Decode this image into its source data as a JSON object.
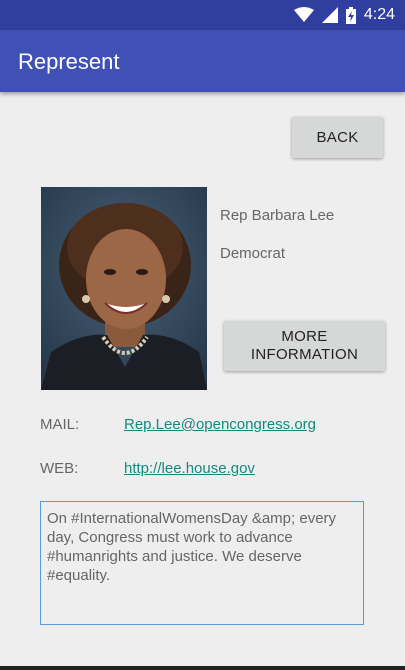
{
  "status_bar": {
    "time": "4:24",
    "icons": [
      "wifi-icon",
      "signal-icon",
      "battery-charging-icon"
    ]
  },
  "app_bar": {
    "title": "Represent"
  },
  "back_button": {
    "label": "BACK"
  },
  "representative": {
    "name": "Rep Barbara Lee",
    "party": "Democrat",
    "photo_alt": "Portrait photo"
  },
  "more_info_button": {
    "label": "MORE INFORMATION"
  },
  "contact": {
    "mail_label": "MAIL:",
    "mail_value": "Rep.Lee@opencongress.org",
    "web_label": "WEB:",
    "web_value": "http://lee.house.gov"
  },
  "tweet": {
    "text": "On #InternationalWomensDay &amp; every day, Congress must work to advance #humanrights and justice. We deserve #equality."
  },
  "colors": {
    "primary": "#3f51b5",
    "primary_dark": "#303f9f",
    "link": "#138a7c",
    "background": "#eeeeee"
  }
}
